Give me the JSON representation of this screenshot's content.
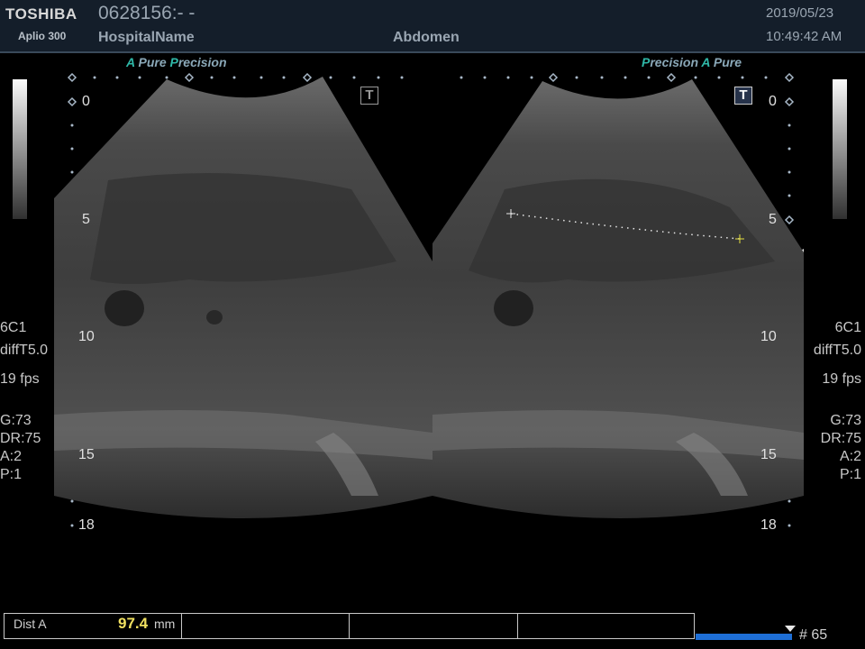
{
  "header": {
    "brand": "TOSHIBA",
    "model": "Aplio 300",
    "patient_id": "0628156:- -",
    "hospital": "HospitalName",
    "exam": "Abdomen",
    "date": "2019/05/23",
    "time": "10:49:42 AM"
  },
  "left_image": {
    "mode_a": "A",
    "mode_pure": "Pure",
    "mode_p": "P",
    "mode_precision": "recision"
  },
  "right_image": {
    "mode_p": "P",
    "mode_precision": "recision",
    "mode_a": "A",
    "mode_pure": "Pure"
  },
  "depth_scale": [
    "0",
    "5",
    "10",
    "15",
    "18"
  ],
  "left_info": {
    "probe": "6C1",
    "preset": "diffT5.0",
    "fps": "19 fps",
    "gain": "G:73",
    "dr": "DR:75",
    "a": "A:2",
    "p": "P:1"
  },
  "right_info": {
    "probe": "6C1",
    "preset": "diffT5.0",
    "fps": "19 fps",
    "gain": "G:73",
    "dr": "DR:75",
    "a": "A:2",
    "p": "P:1"
  },
  "measurement": {
    "label": "Dist A",
    "value": "97.4",
    "unit": "mm"
  },
  "frame": "# 65",
  "colors": {
    "accent": "#2fb8a8",
    "measurement_value": "#f0e060",
    "cine_bar": "#1e6fd6"
  }
}
